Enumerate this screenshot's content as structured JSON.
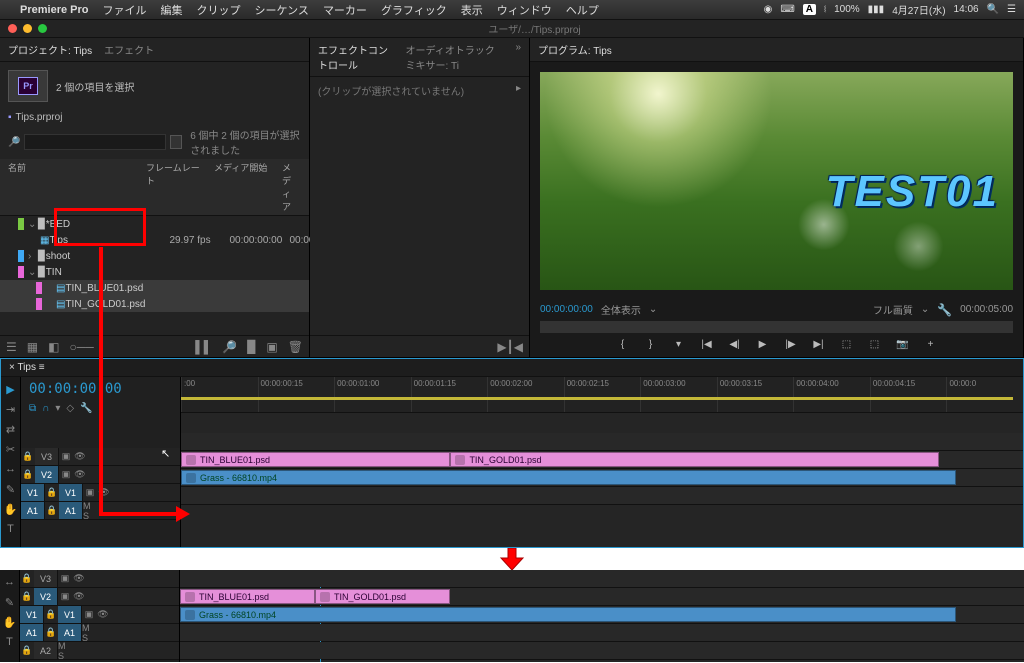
{
  "menubar": {
    "app": "Premiere Pro",
    "items": [
      "ファイル",
      "編集",
      "クリップ",
      "シーケンス",
      "マーカー",
      "グラフィック",
      "表示",
      "ウィンドウ",
      "ヘルプ"
    ],
    "right": {
      "battery": "100%",
      "date": "4月27日(水)",
      "time": "14:06"
    }
  },
  "titlebar": {
    "title": "ユーザ/…/Tips.prproj"
  },
  "projectPanel": {
    "tabs": [
      "プロジェクト: Tips",
      "エフェクト"
    ],
    "selectionInfo": "2 個の項目を選択",
    "fileName": "Tips.prproj",
    "searchPlaceholder": "",
    "selectionStatus": "6 個中 2 個の項目が選択されました",
    "columns": [
      "名前",
      "フレームレート",
      "メディア開始",
      "メディア"
    ],
    "tree": {
      "feed": {
        "name": "*EED"
      },
      "tipsSeq": {
        "name": "Tips",
        "fps": "29.97 fps",
        "start": "00:00:00:00",
        "media": "00:00:0"
      },
      "shoot": {
        "name": "shoot"
      },
      "tin": {
        "name": "TIN"
      },
      "tinBlue": {
        "name": "TIN_BLUE01.psd"
      },
      "tinGold": {
        "name": "TIN_GOLD01.psd"
      }
    }
  },
  "effectPanel": {
    "tabs": [
      "エフェクトコントロール",
      "オーディオトラックミキサー: Ti"
    ],
    "noClip": "(クリップが選択されていません)"
  },
  "programPanel": {
    "tab": "プログラム: Tips",
    "overlayText": "TEST01",
    "tcLeft": "00:00:00:00",
    "fit": "全体表示",
    "quality": "フル画質",
    "tcRight": "00:00:05:00"
  },
  "timeline": {
    "tab": "Tips",
    "tc": "00:00:00:00",
    "ruler": [
      ":00",
      "00:00:00:15",
      "00:00:01:00",
      "00:00:01:15",
      "00:00:02:00",
      "00:00:02:15",
      "00:00:03:00",
      "00:00:03:15",
      "00:00:04:00",
      "00:00:04:15",
      "00:00:0"
    ],
    "tracks": {
      "v3": "V3",
      "v2": "V2",
      "v1": "V1",
      "a1": "A1",
      "a2": "A2"
    },
    "clips": {
      "tinBlue": "TIN_BLUE01.psd",
      "tinGold": "TIN_GOLD01.psd",
      "grass": "Grass - 66810.mp4"
    },
    "audioMeta": "M S"
  }
}
